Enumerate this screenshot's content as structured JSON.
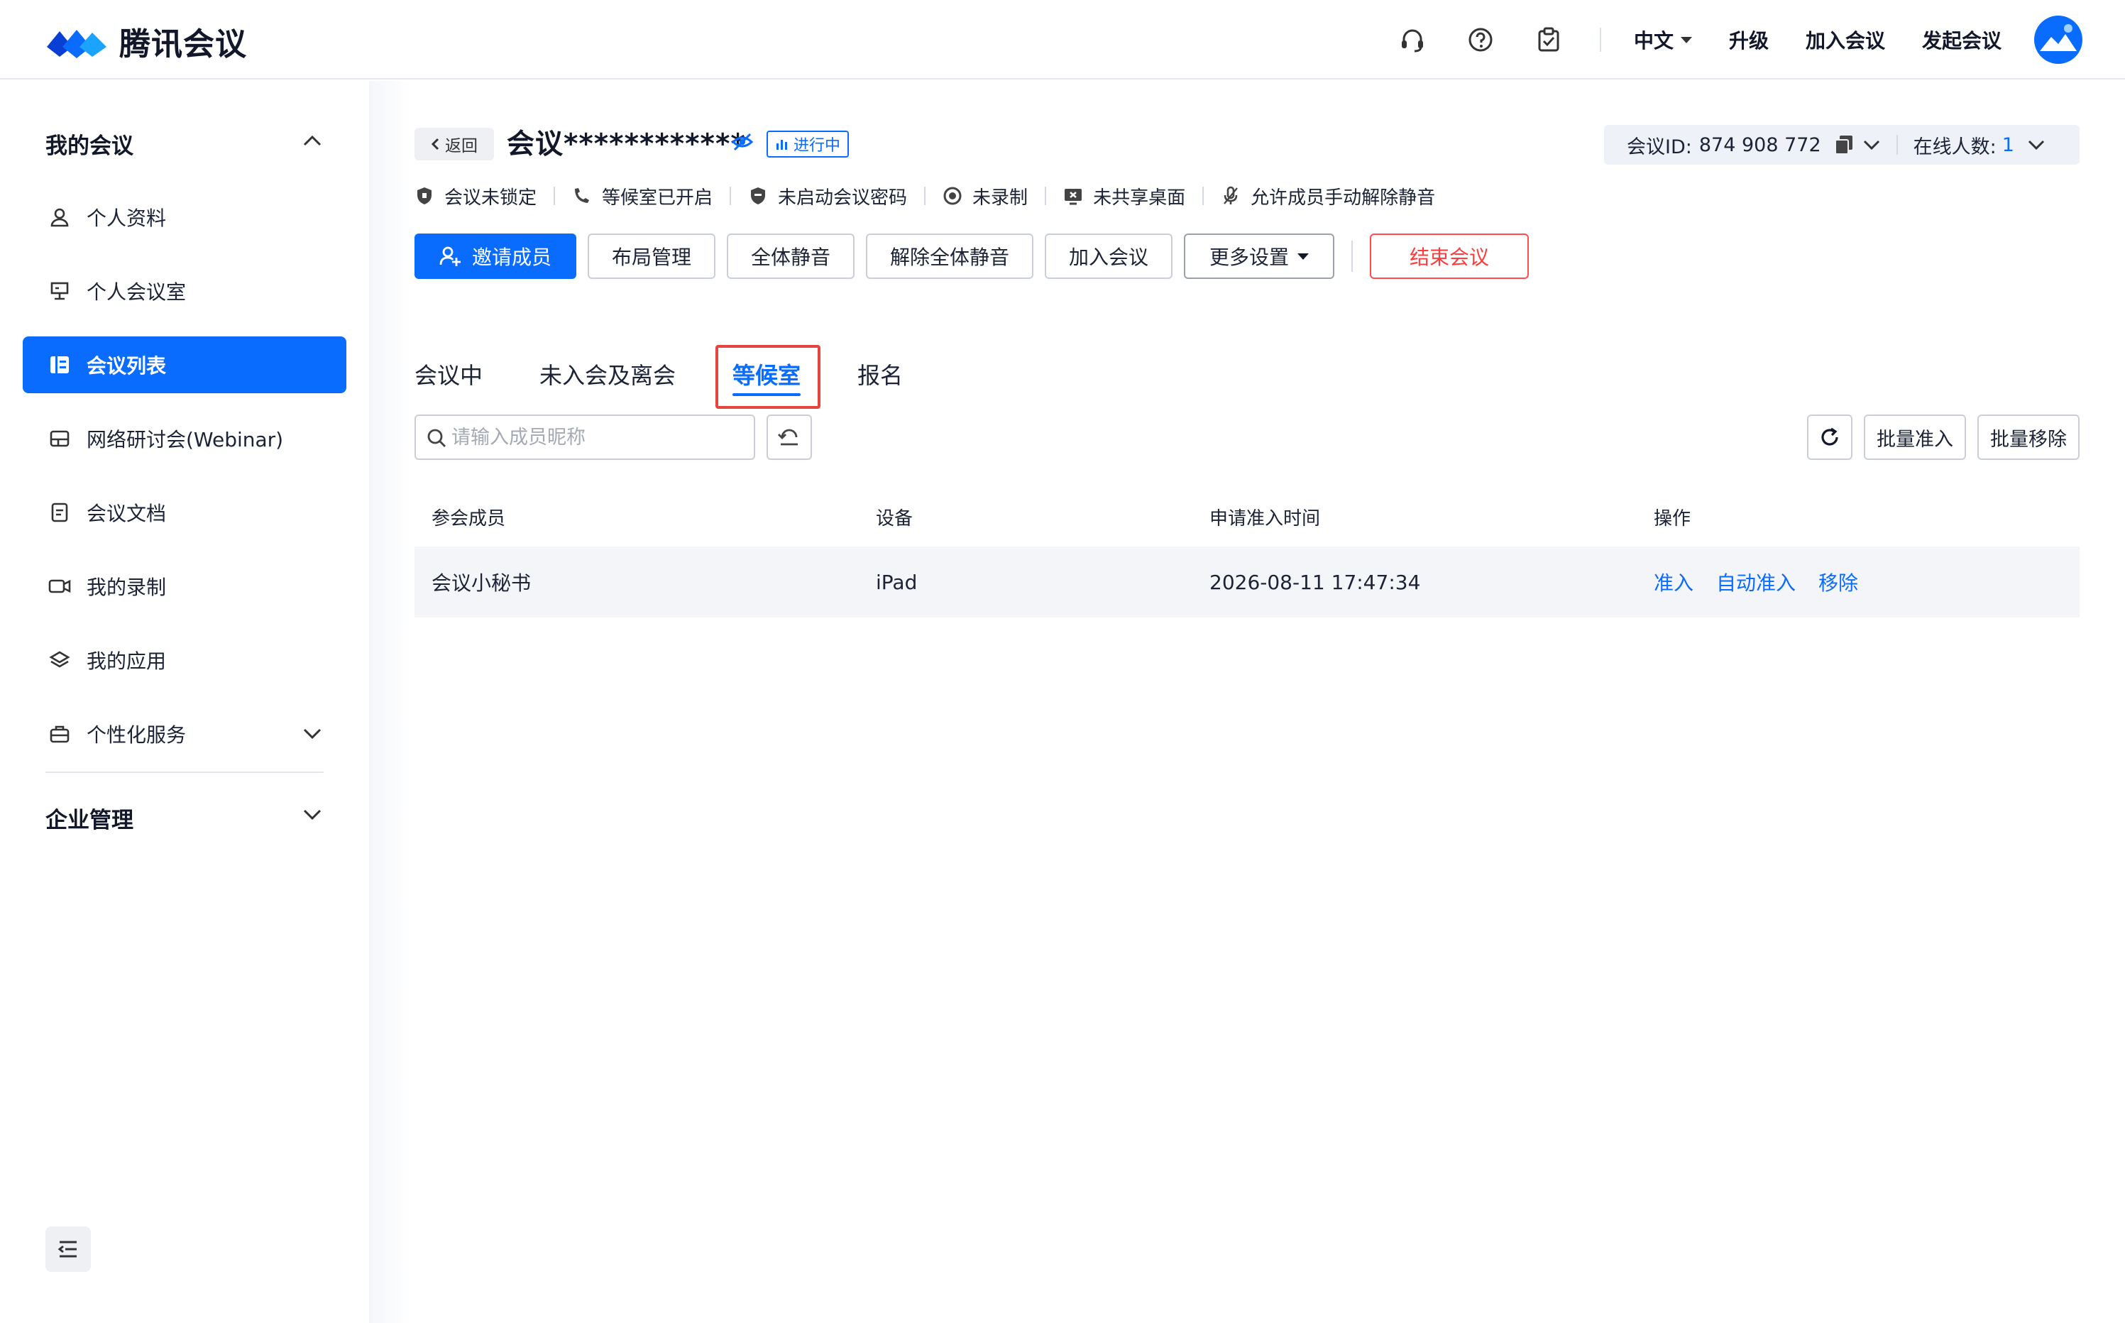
{
  "app": {
    "name": "腾讯会议",
    "brand_color": "#0a6cff"
  },
  "topbar": {
    "icons": [
      "headset-icon",
      "help-icon",
      "clipboard-check-icon"
    ],
    "language": "中文",
    "upgrade": "升级",
    "join_meeting": "加入会议",
    "start_meeting": "发起会议"
  },
  "sidebar": {
    "group_my_meetings": "我的会议",
    "items": [
      {
        "label": "个人资料",
        "icon": "user-icon"
      },
      {
        "label": "个人会议室",
        "icon": "podium-icon"
      },
      {
        "label": "会议列表",
        "icon": "list-icon",
        "active": true
      },
      {
        "label": "网络研讨会(Webinar)",
        "icon": "webinar-icon"
      },
      {
        "label": "会议文档",
        "icon": "document-icon"
      },
      {
        "label": "我的录制",
        "icon": "video-icon"
      },
      {
        "label": "我的应用",
        "icon": "layers-icon"
      },
      {
        "label": "个性化服务",
        "icon": "briefcase-icon"
      }
    ],
    "group_enterprise": "企业管理"
  },
  "meeting": {
    "back_label": "返回",
    "title": "会议************",
    "status_tag": "进行中",
    "id_label": "会议ID:",
    "id_value": "874 908 772",
    "online_label": "在线人数:",
    "online_count": "1",
    "status_items": [
      {
        "label": "会议未锁定",
        "icon": "shield-icon"
      },
      {
        "label": "等候室已开启",
        "icon": "waiting-room-icon"
      },
      {
        "label": "未启动会议密码",
        "icon": "shield-lock-icon"
      },
      {
        "label": "未录制",
        "icon": "record-icon"
      },
      {
        "label": "未共享桌面",
        "icon": "screen-share-off-icon"
      },
      {
        "label": "允许成员手动解除静音",
        "icon": "mic-icon"
      }
    ]
  },
  "actions": {
    "invite": "邀请成员",
    "layout": "布局管理",
    "mute_all": "全体静音",
    "unmute_all": "解除全体静音",
    "join": "加入会议",
    "more": "更多设置",
    "end": "结束会议"
  },
  "tabs": [
    {
      "label": "会议中"
    },
    {
      "label": "未入会及离会"
    },
    {
      "label": "等候室",
      "active": true
    },
    {
      "label": "报名"
    }
  ],
  "search": {
    "placeholder": "请输入成员昵称",
    "value": ""
  },
  "tools": {
    "batch_admit": "批量准入",
    "batch_remove": "批量移除"
  },
  "table": {
    "columns": [
      "参会成员",
      "设备",
      "申请准入时间",
      "操作"
    ],
    "rows": [
      {
        "member": "会议小秘书",
        "device": "iPad",
        "time": "2026-08-11 17:47:34",
        "ops": [
          "准入",
          "自动准入",
          "移除"
        ]
      }
    ]
  }
}
